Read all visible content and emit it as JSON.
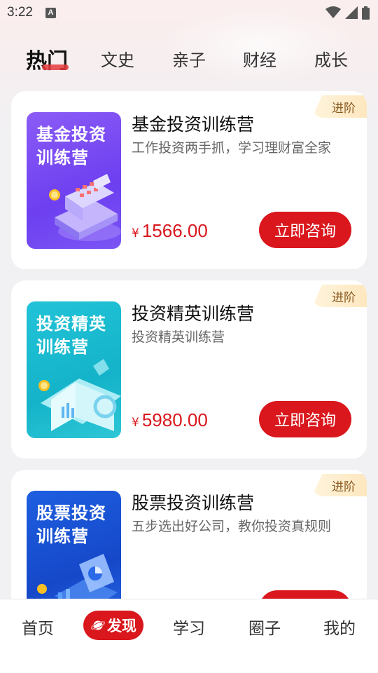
{
  "status_bar": {
    "time": "3:22",
    "notif_letter": "A"
  },
  "tabs": [
    {
      "label": "热门",
      "active": true
    },
    {
      "label": "文史"
    },
    {
      "label": "亲子"
    },
    {
      "label": "财经"
    },
    {
      "label": "成长"
    }
  ],
  "cards": [
    {
      "badge": "进阶",
      "thumb_title": "基金投资\n训练营",
      "title": "基金投资训练营",
      "desc": "工作投资两手抓，学习理财富全家",
      "price_symbol": "¥",
      "price": "1566.00",
      "button": "立即咨询"
    },
    {
      "badge": "进阶",
      "thumb_title": "投资精英\n训练营",
      "title": "投资精英训练营",
      "desc": "投资精英训练营",
      "price_symbol": "¥",
      "price": "5980.00",
      "button": "立即咨询"
    },
    {
      "badge": "进阶",
      "thumb_title": "股票投资\n训练营",
      "title": "股票投资训练营",
      "desc": "五步选出好公司，教你投资真规则",
      "price_symbol": "¥",
      "price": "",
      "button": ""
    }
  ],
  "bottom_nav": [
    {
      "label": "首页"
    },
    {
      "label": "发现",
      "active": true
    },
    {
      "label": "学习"
    },
    {
      "label": "圈子"
    },
    {
      "label": "我的"
    }
  ],
  "colors": {
    "accent": "#d9171d",
    "badge_text": "#8a5a20"
  }
}
